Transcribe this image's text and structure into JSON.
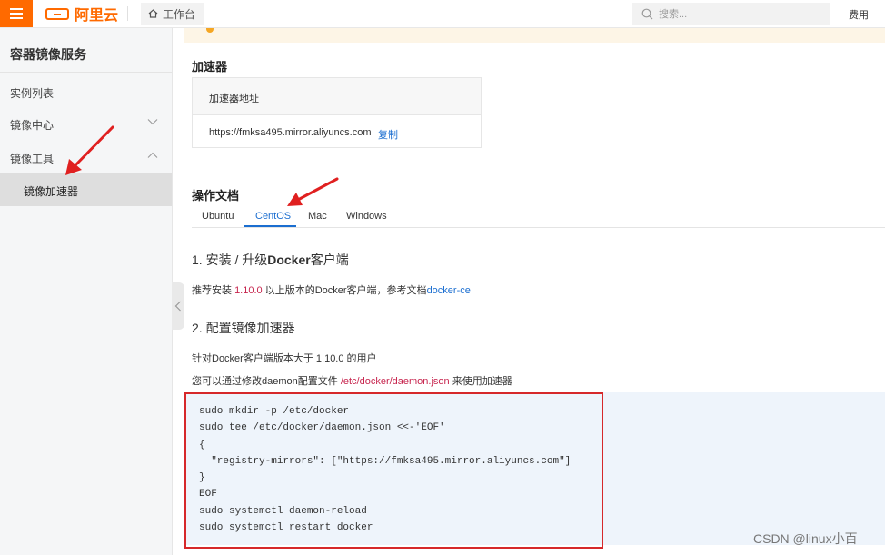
{
  "topbar": {
    "logo_text": "阿里云",
    "workbench_label": "工作台",
    "search_placeholder": "搜索...",
    "fee_label": "费用"
  },
  "sidebar": {
    "title": "容器镜像服务",
    "items": [
      {
        "label": "实例列表"
      },
      {
        "label": "镜像中心",
        "expanded": false
      },
      {
        "label": "镜像工具",
        "expanded": true
      },
      {
        "label": "镜像加速器",
        "active": true
      }
    ]
  },
  "accelerator": {
    "heading": "加速器",
    "table_header": "加速器地址",
    "url": "https://fmksa495.mirror.aliyuncs.com",
    "copy_label": "复制"
  },
  "docs": {
    "heading": "操作文档",
    "tabs": [
      {
        "label": "Ubuntu"
      },
      {
        "label": "CentOS",
        "active": true
      },
      {
        "label": "Mac"
      },
      {
        "label": "Windows"
      }
    ],
    "section1": {
      "prefix": "1. 安装 / 升级",
      "bold": "Docker",
      "suffix": "客户端"
    },
    "recommend": {
      "prefix": "推荐安装 ",
      "version": "1.10.0",
      "middle": " 以上版本的Docker客户端，参考文档",
      "link": "docker-ce"
    },
    "section2": "2. 配置镜像加速器",
    "note1": "针对Docker客户端版本大于 1.10.0 的用户",
    "note2": {
      "prefix": "您可以通过修改daemon配置文件 ",
      "path": "/etc/docker/daemon.json",
      "suffix": " 来使用加速器"
    },
    "code": "sudo mkdir -p /etc/docker\nsudo tee /etc/docker/daemon.json <<-'EOF'\n{\n  \"registry-mirrors\": [\"https://fmksa495.mirror.aliyuncs.com\"]\n}\nEOF\nsudo systemctl daemon-reload\nsudo systemctl restart docker"
  },
  "watermark": "CSDN @linux小百",
  "colors": {
    "brand": "#ff6a00",
    "link": "#1b6ed0",
    "highlight_box": "#d6282a",
    "annotation_arrow": "#e02020"
  }
}
